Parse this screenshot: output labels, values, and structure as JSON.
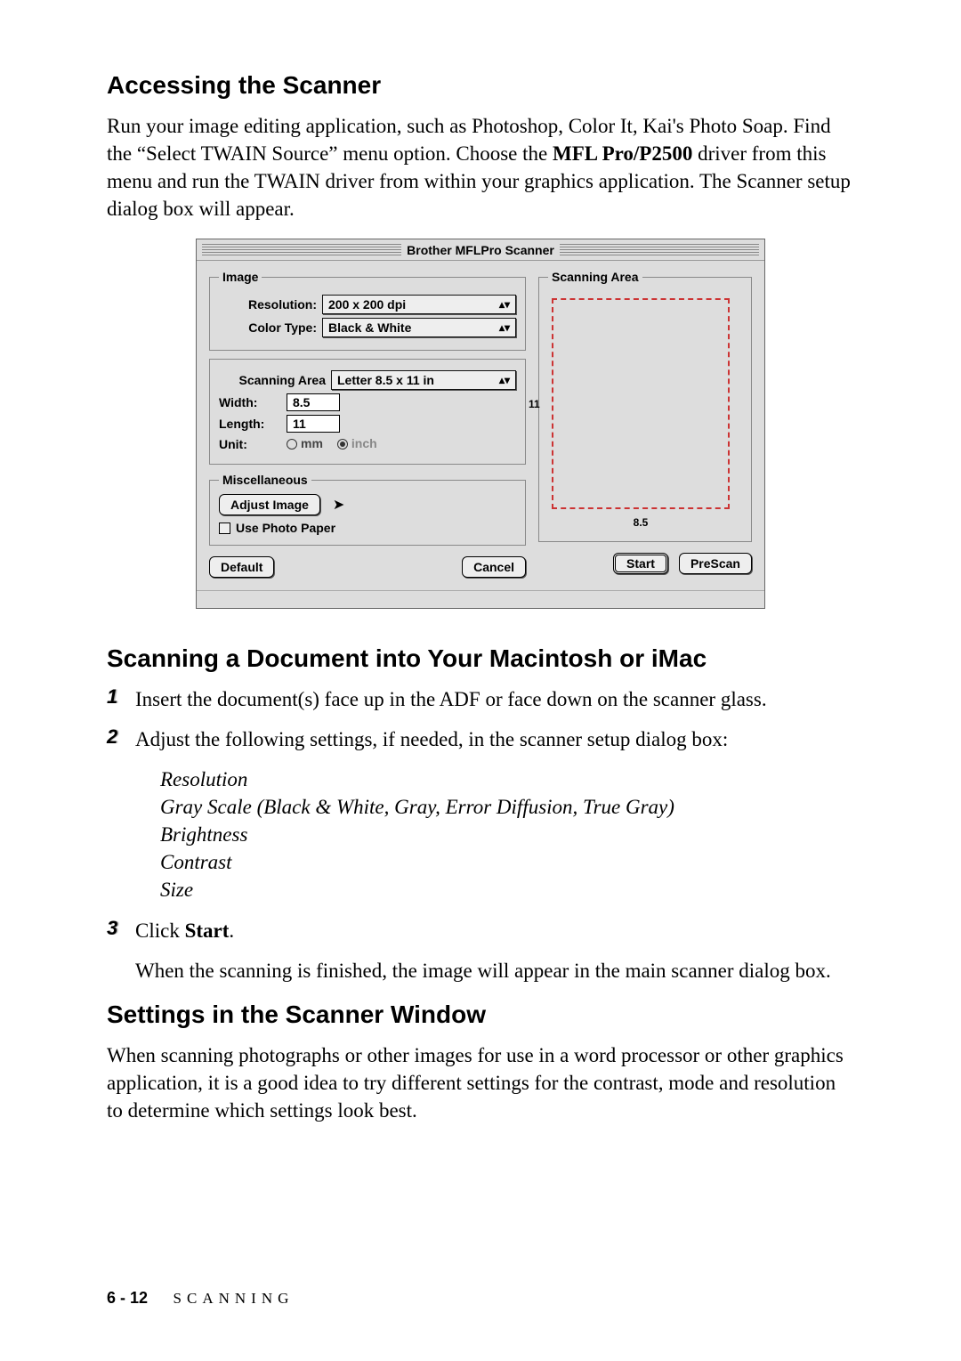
{
  "headings": {
    "h1": "Accessing the Scanner",
    "h2": "Scanning a Document into Your Macintosh or iMac",
    "h3": "Settings in the Scanner Window"
  },
  "intro": {
    "p1a": "Run your image editing application, such as Photoshop, Color It, Kai's Photo Soap. Find the “Select TWAIN Source” menu option. Choose the ",
    "p1b": "MFL Pro/P2500",
    "p1c": " driver from this menu and run the TWAIN driver from within your graphics application. The Scanner setup dialog box will appear."
  },
  "dialog": {
    "title": "Brother MFLPro Scanner",
    "groups": {
      "image": "Image",
      "scanArea": "Scanning Area",
      "misc": "Miscellaneous"
    },
    "labels": {
      "resolution": "Resolution:",
      "colorType": "Color Type:",
      "scanningArea": "Scanning Area",
      "width": "Width:",
      "length": "Length:",
      "unit": "Unit:"
    },
    "values": {
      "resolution": "200 x 200 dpi",
      "colorType": "Black & White",
      "scanningArea": "Letter 8.5 x 11 in",
      "width": "8.5",
      "length": "11"
    },
    "units": {
      "mm": "mm",
      "inch": "inch"
    },
    "misc": {
      "adjustImage": "Adjust Image",
      "usePhotoPaper": "Use Photo Paper"
    },
    "buttons": {
      "default": "Default",
      "cancel": "Cancel",
      "start": "Start",
      "prescan": "PreScan"
    },
    "preview": {
      "widthTick": "8.5",
      "heightTick": "11"
    }
  },
  "steps": {
    "n1": "1",
    "n2": "2",
    "n3": "3",
    "s1": "Insert the document(s) face up in the ADF or face down on the scanner glass.",
    "s2": "Adjust the following settings, if needed, in the scanner setup dialog box:",
    "sub": {
      "a": "Resolution",
      "b": "Gray Scale (Black & White, Gray, Error Diffusion, True Gray)",
      "c": "Brightness",
      "d": "Contrast",
      "e": "Size"
    },
    "s3a": "Click ",
    "s3b": "Start",
    "s3c": ".",
    "after": "When the scanning is finished, the image will appear in the main scanner dialog box."
  },
  "settingsPara": "When scanning photographs or other images for use in a word processor or other graphics application, it is a good idea to try different settings for the contrast, mode and resolution to determine which settings look best.",
  "footer": {
    "page": "6 - 12",
    "label": "SCANNING"
  }
}
